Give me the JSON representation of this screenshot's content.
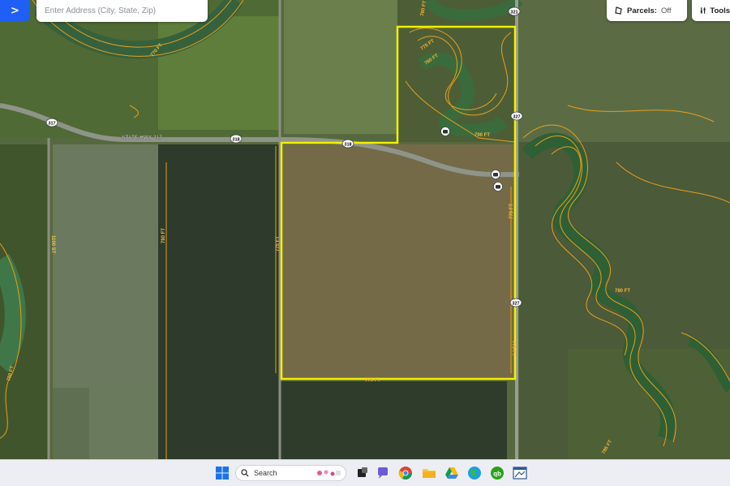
{
  "toolbar": {
    "menu_icon": "chevron-right-icon",
    "search_placeholder": "Enter Address (City, State, Zip)",
    "parcels_label": "Parcels:",
    "parcels_state": "Off",
    "tools_label": "Tools"
  },
  "map": {
    "road_label": "STATE HWY 317",
    "shields": [
      "317",
      "318",
      "318",
      "321",
      "327",
      "327"
    ],
    "contour_labels": [
      "770 FT",
      "780 FT",
      "775 FT",
      "780 FT",
      "790 FT",
      "775 FT",
      "780 FT",
      "770 FT",
      "775 FT",
      "775 FT",
      "780 FT",
      "780 FT",
      "785 FT",
      "775 FT",
      "790 FT",
      "770 FT",
      "775 FT"
    ],
    "street_label": "1100 ST",
    "colors": {
      "boundary": "#f2f000",
      "contour": "#e8a01c"
    }
  },
  "taskbar": {
    "search_text": "Search",
    "apps": [
      "windows-start",
      "search",
      "task-view",
      "chat",
      "chrome",
      "file-explorer",
      "google-drive",
      "edge-globe",
      "quickbooks",
      "app-window"
    ]
  }
}
